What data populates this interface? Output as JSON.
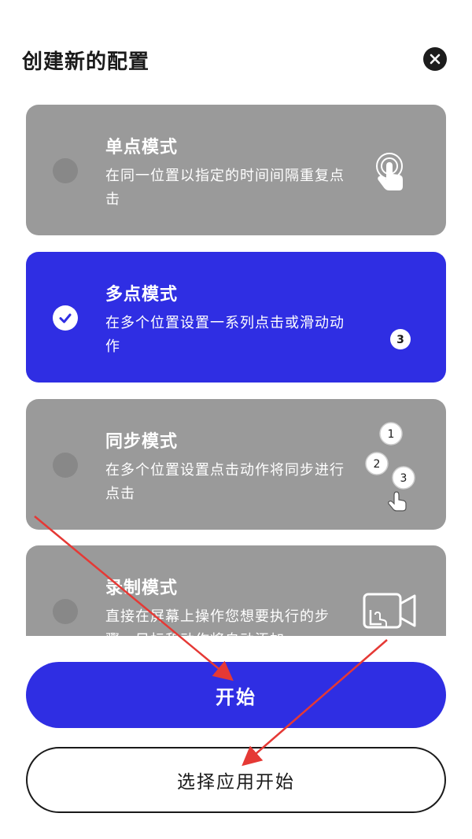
{
  "dialog": {
    "title": "创建新的配置"
  },
  "modes": [
    {
      "title": "单点模式",
      "description": "在同一位置以指定的时间间隔重复点击",
      "selected": false,
      "icon": "tap-finger-icon"
    },
    {
      "title": "多点模式",
      "description": "在多个位置设置一系列点击或滑动动作",
      "selected": true,
      "icon": "numbered-badge-icon",
      "badge": "3"
    },
    {
      "title": "同步模式",
      "description": "在多个位置设置点击动作将同步进行点击",
      "selected": false,
      "icon": "sync-targets-icon",
      "targets": [
        "1",
        "2",
        "3"
      ]
    },
    {
      "title": "录制模式",
      "description": "直接在屏幕上操作您想要执行的步骤，目标和动作将自动添加",
      "selected": false,
      "icon": "record-screen-icon"
    }
  ],
  "actions": {
    "start_label": "开始",
    "select_app_label": "选择应用开始"
  },
  "colors": {
    "accent": "#2f2ee3",
    "card_inactive": "#9a9a9a",
    "annotation_arrow": "#e53935"
  }
}
